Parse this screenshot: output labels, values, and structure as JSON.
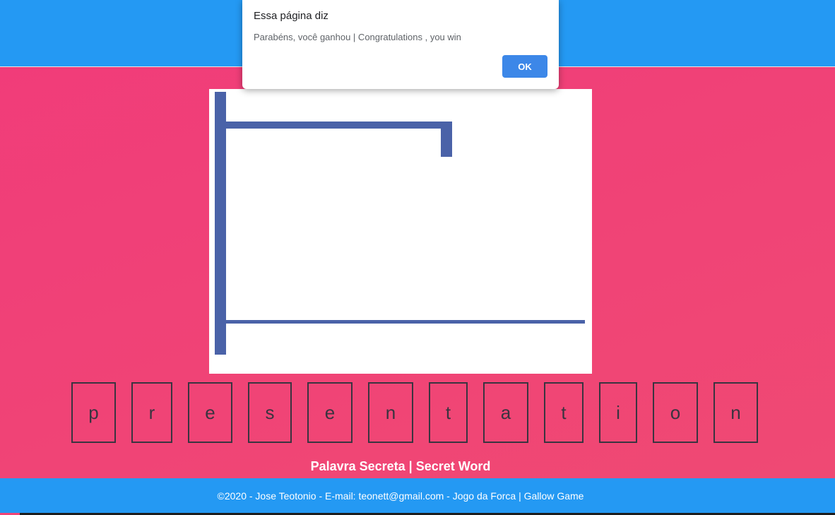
{
  "dialog": {
    "title": "Essa página diz",
    "message": "Parabéns, você ganhou | Congratulations , you win",
    "ok_label": "OK"
  },
  "game": {
    "secret_letters": [
      "p",
      "r",
      "e",
      "s",
      "e",
      "n",
      "t",
      "a",
      "t",
      "i",
      "o",
      "n"
    ],
    "secret_word_label": "Palavra Secreta | Secret Word"
  },
  "footer": {
    "text": "©2020 - Jose Teotonio - E-mail: teonett@gmail.com - Jogo da Forca | Gallow Game"
  },
  "colors": {
    "header_blue": "#2499f3",
    "background_pink": "#f13b7a",
    "gallows_stroke": "#4a62a8",
    "ok_button": "#3c87e8"
  }
}
